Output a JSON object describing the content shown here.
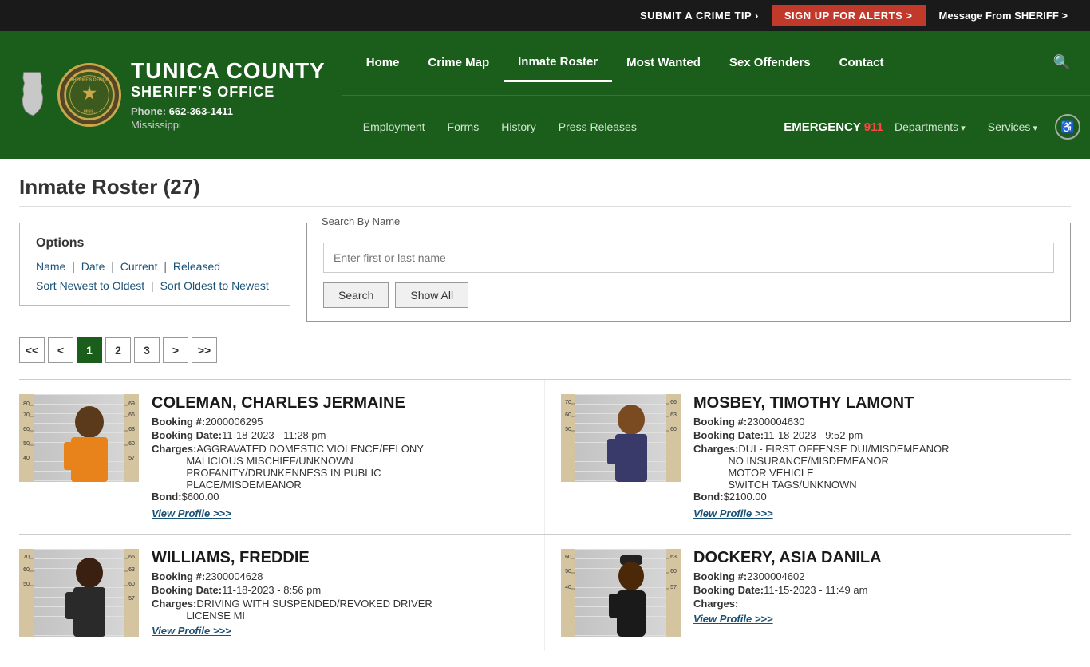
{
  "topbar": {
    "submit_tip": "SUBMIT A CRIME TIP >",
    "submit_tip_prefix": "SUBMIT A ",
    "submit_tip_highlight": "CRIME TIP",
    "submit_tip_arrow": " >",
    "alerts": "SIGN UP FOR ALERTS >",
    "message_prefix": "Message From ",
    "message_highlight": "SHERIFF",
    "message_suffix": " >"
  },
  "header": {
    "org_line1": "TUNICA COUNTY",
    "org_line2": "SHERIFF'S OFFICE",
    "phone_label": "Phone:",
    "phone": "662-363-1411",
    "state": "Mississippi",
    "seal_text": "SHERIFF'S OFFICE MISS.",
    "nav_primary": [
      {
        "label": "Home",
        "active": false
      },
      {
        "label": "Crime Map",
        "active": false
      },
      {
        "label": "Inmate Roster",
        "active": true
      },
      {
        "label": "Most Wanted",
        "active": false
      },
      {
        "label": "Sex Offenders",
        "active": false
      },
      {
        "label": "Contact",
        "active": false
      }
    ],
    "nav_secondary": [
      {
        "label": "Employment"
      },
      {
        "label": "Forms"
      },
      {
        "label": "History"
      },
      {
        "label": "Press Releases"
      }
    ],
    "emergency_label": "EMERGENCY",
    "emergency_number": "911",
    "departments": "Departments",
    "services": "Services"
  },
  "page": {
    "title": "Inmate Roster (27)"
  },
  "options": {
    "title": "Options",
    "links": [
      "Name",
      "Date",
      "Current",
      "Released"
    ],
    "sort_links": [
      "Sort Newest to Oldest",
      "Sort Oldest to Newest"
    ]
  },
  "search": {
    "legend": "Search By Name",
    "placeholder": "Enter first or last name",
    "search_btn": "Search",
    "show_all_btn": "Show All"
  },
  "pagination": {
    "pages": [
      "<<",
      "<",
      "1",
      "2",
      "3",
      ">",
      ">>"
    ],
    "active_page": "1"
  },
  "inmates": [
    {
      "name": "COLEMAN, CHARLES JERMAINE",
      "booking_num": "2000006295",
      "booking_date": "11-18-2023 - 11:28 pm",
      "charges": [
        "AGGRAVATED DOMESTIC VIOLENCE/FELONY",
        "MALICIOUS MISCHIEF/UNKNOWN",
        "PROFANITY/DRUNKENNESS IN PUBLIC PLACE/MISDEMEANOR"
      ],
      "bond": "$600.00",
      "view_profile": "View Profile >>>"
    },
    {
      "name": "MOSBEY, TIMOTHY LAMONT",
      "booking_num": "2300004630",
      "booking_date": "11-18-2023 - 9:52 pm",
      "charges": [
        "DUI - FIRST OFFENSE DUI/MISDEMEANOR",
        "NO INSURANCE/MISDEMEANOR",
        "MOTOR VEHICLE",
        "SWITCH TAGS/UNKNOWN"
      ],
      "bond": "$2100.00",
      "view_profile": "View Profile >>>"
    },
    {
      "name": "WILLIAMS, FREDDIE",
      "booking_num": "2300004628",
      "booking_date": "11-18-2023 - 8:56 pm",
      "charges": [
        "DRIVING WITH SUSPENDED/REVOKED DRIVER LICENSE MI"
      ],
      "bond": "",
      "view_profile": "View Profile >>>"
    },
    {
      "name": "DOCKERY, ASIA DANILA",
      "booking_num": "2300004602",
      "booking_date": "11-15-2023 - 11:49 am",
      "charges": [],
      "bond": "",
      "view_profile": "View Profile >>>"
    }
  ],
  "labels": {
    "booking_num": "Booking #:",
    "booking_date": "Booking Date:",
    "charges": "Charges:",
    "bond": "Bond:"
  }
}
